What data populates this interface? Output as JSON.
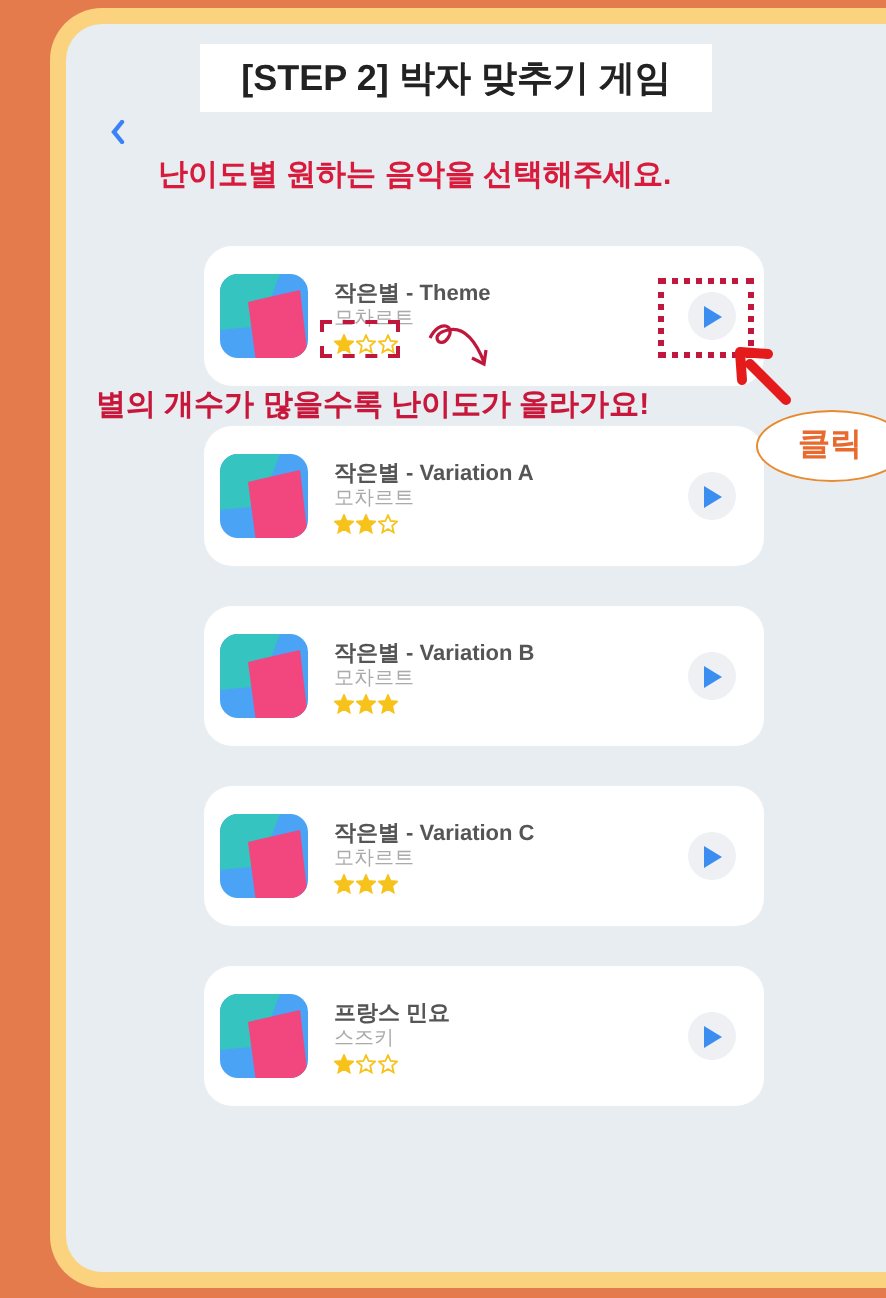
{
  "title": "[STEP 2] 박자 맞추기 게임",
  "subtitle": "난이도별 원하는 음악을 선택해주세요.",
  "songs": [
    {
      "title": "작은별 - Theme",
      "composer": "모차르트",
      "stars": 1
    },
    {
      "title": "작은별 - Variation A",
      "composer": "모차르트",
      "stars": 2
    },
    {
      "title": "작은별 - Variation B",
      "composer": "모차르트",
      "stars": 3
    },
    {
      "title": "작은별 - Variation C",
      "composer": "모차르트",
      "stars": 3
    },
    {
      "title": "프랑스 민요",
      "composer": "스즈키",
      "stars": 1
    }
  ],
  "annotation": {
    "note": "별의 개수가 많을수록 난이도가 올라가요!",
    "click_label": "클릭"
  }
}
